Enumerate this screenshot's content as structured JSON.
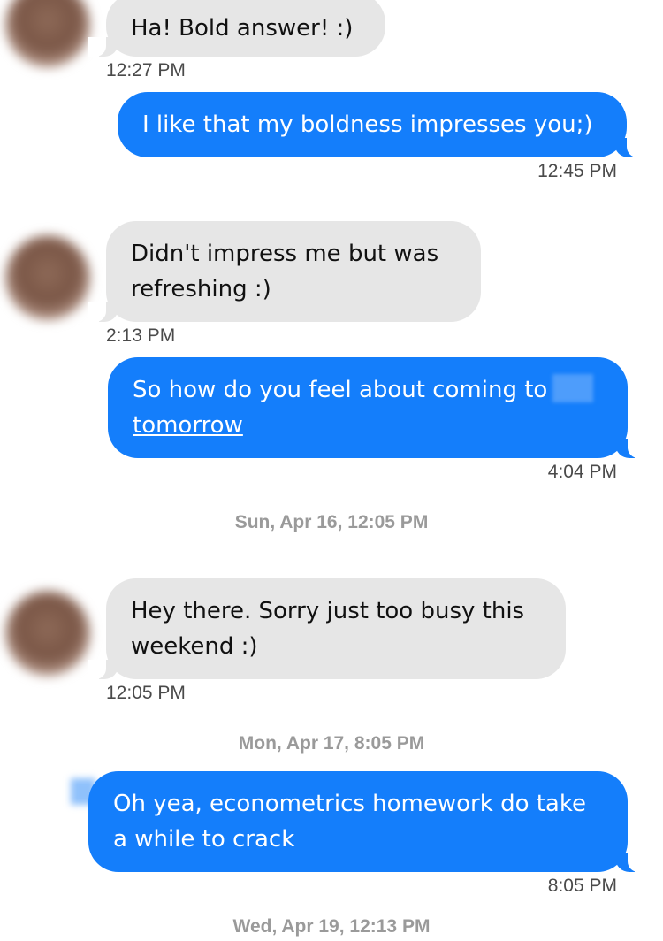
{
  "colors": {
    "incoming_bubble": "#e6e6e6",
    "outgoing_bubble": "#147efb",
    "timestamp": "#4a4a4a",
    "day_separator": "#9a9a9a"
  },
  "messages": [
    {
      "direction": "incoming",
      "text": "Ha! Bold answer! :)",
      "time": "12:27 PM"
    },
    {
      "direction": "outgoing",
      "text": "I like that my boldness impresses you;)",
      "time": "12:45 PM"
    },
    {
      "direction": "incoming",
      "text": "Didn't impress me but was refreshing :)",
      "time": "2:13 PM"
    },
    {
      "direction": "outgoing",
      "text": "So how do you feel about coming to",
      "link_text": "tomorrow",
      "time": "4:04 PM"
    },
    {
      "direction": "incoming",
      "text": "Hey there. Sorry just too busy this weekend :)",
      "time": "12:05 PM"
    },
    {
      "direction": "outgoing",
      "text": "Oh yea, econometrics homework do take a while to crack",
      "time": "8:05 PM"
    }
  ],
  "day_separators": [
    "Sun, Apr 16, 12:05 PM",
    "Mon, Apr 17, 8:05 PM",
    "Wed, Apr 19, 12:13 PM"
  ]
}
